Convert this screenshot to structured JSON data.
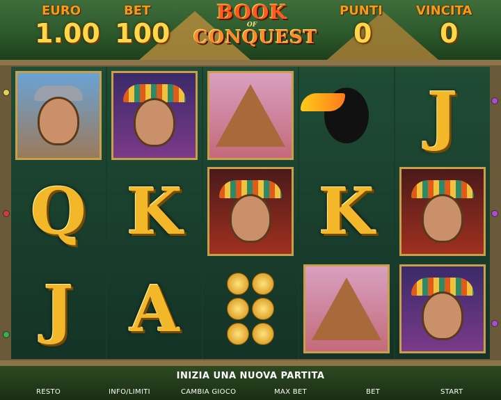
{
  "header": {
    "euro_label": "EURO",
    "euro_value": "1.00",
    "bet_label": "BET",
    "bet_value": "100",
    "punti_label": "PUNTI",
    "punti_value": "0",
    "vincita_label": "VINCITA",
    "vincita_value": "0",
    "logo_top": "BOOK",
    "logo_mid": "OF",
    "logo_bottom": "CONQUEST"
  },
  "reels": [
    [
      "conquistador",
      "Q",
      "J"
    ],
    [
      "aztec-warrior",
      "K",
      "A"
    ],
    [
      "pyramid",
      "aztec-woman",
      "gold-coins"
    ],
    [
      "toucan",
      "K",
      "pyramid"
    ],
    [
      "J",
      "aztec-woman",
      "aztec-warrior"
    ]
  ],
  "status": "INIZIA UNA NUOVA PARTITA",
  "buttons": {
    "resto": "RESTO",
    "info": "INFO/LIMITI",
    "cambia": "CAMBIA GIOCO",
    "maxbet": "MAX BET",
    "bet": "BET",
    "start": "START"
  },
  "colors": {
    "label": "#f39c17",
    "value": "#ffd84a",
    "letter": "#f3b72a"
  }
}
